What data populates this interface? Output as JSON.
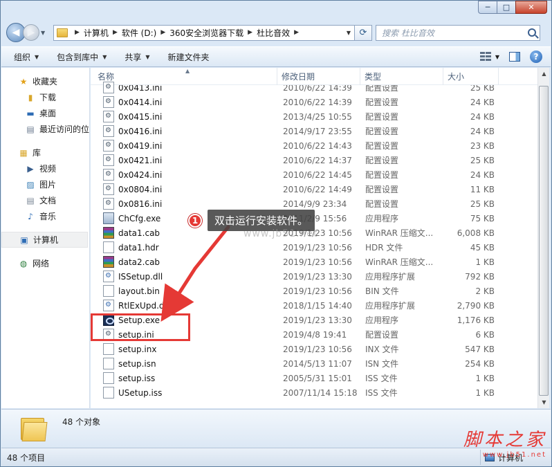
{
  "window": {
    "caption": {
      "min": "─",
      "max": "□",
      "close": "✕"
    }
  },
  "address": {
    "crumbs": [
      "计算机",
      "软件 (D:)",
      "360安全浏览器下载",
      "杜比音效"
    ],
    "search_placeholder": "搜索 杜比音效"
  },
  "commands": [
    {
      "label": "组织",
      "dropdown": true
    },
    {
      "label": "包含到库中",
      "dropdown": true
    },
    {
      "label": "共享",
      "dropdown": true
    },
    {
      "label": "新建文件夹",
      "dropdown": false
    }
  ],
  "nav": {
    "items": [
      {
        "label": "收藏夹",
        "icon": "star-icon",
        "indent": 1,
        "gap_before": 0
      },
      {
        "label": "下载",
        "icon": "download-folder-icon",
        "indent": 2,
        "gap_before": 0
      },
      {
        "label": "桌面",
        "icon": "desktop-icon",
        "indent": 2,
        "gap_before": 0
      },
      {
        "label": "最近访问的位置",
        "icon": "recent-places-icon",
        "indent": 2,
        "gap_before": 0
      },
      {
        "label": "库",
        "icon": "library-icon",
        "indent": 1,
        "gap_before": 1
      },
      {
        "label": "视频",
        "icon": "video-icon",
        "indent": 2,
        "gap_before": 0
      },
      {
        "label": "图片",
        "icon": "pictures-icon",
        "indent": 2,
        "gap_before": 0
      },
      {
        "label": "文档",
        "icon": "documents-icon",
        "indent": 2,
        "gap_before": 0
      },
      {
        "label": "音乐",
        "icon": "music-icon",
        "indent": 2,
        "gap_before": 0
      },
      {
        "label": "计算机",
        "icon": "computer-icon",
        "indent": 1,
        "gap_before": 1,
        "selected": true
      },
      {
        "label": "网络",
        "icon": "network-icon",
        "indent": 1,
        "gap_before": 1
      }
    ]
  },
  "columns": {
    "name": "名称",
    "date": "修改日期",
    "type": "类型",
    "size": "大小"
  },
  "files": [
    {
      "name": "0x0413.ini",
      "date": "2010/6/22 14:39",
      "type": "配置设置",
      "size": "25 KB",
      "kind": "ini"
    },
    {
      "name": "0x0414.ini",
      "date": "2010/6/22 14:39",
      "type": "配置设置",
      "size": "24 KB",
      "kind": "ini"
    },
    {
      "name": "0x0415.ini",
      "date": "2013/4/25 10:55",
      "type": "配置设置",
      "size": "24 KB",
      "kind": "ini"
    },
    {
      "name": "0x0416.ini",
      "date": "2014/9/17 23:55",
      "type": "配置设置",
      "size": "24 KB",
      "kind": "ini"
    },
    {
      "name": "0x0419.ini",
      "date": "2010/6/22 14:43",
      "type": "配置设置",
      "size": "23 KB",
      "kind": "ini"
    },
    {
      "name": "0x0421.ini",
      "date": "2010/6/22 14:37",
      "type": "配置设置",
      "size": "25 KB",
      "kind": "ini"
    },
    {
      "name": "0x0424.ini",
      "date": "2010/6/22 14:45",
      "type": "配置设置",
      "size": "24 KB",
      "kind": "ini"
    },
    {
      "name": "0x0804.ini",
      "date": "2010/6/22 14:49",
      "type": "配置设置",
      "size": "11 KB",
      "kind": "ini"
    },
    {
      "name": "0x0816.ini",
      "date": "2014/9/9 23:34",
      "type": "配置设置",
      "size": "25 KB",
      "kind": "ini"
    },
    {
      "name": "ChCfg.exe",
      "date": "2011/2/9 15:56",
      "type": "应用程序",
      "size": "75 KB",
      "kind": "exe"
    },
    {
      "name": "data1.cab",
      "date": "2019/1/23 10:56",
      "type": "WinRAR 压缩文...",
      "size": "6,008 KB",
      "kind": "cab"
    },
    {
      "name": "data1.hdr",
      "date": "2019/1/23 10:56",
      "type": "HDR 文件",
      "size": "45 KB",
      "kind": "file"
    },
    {
      "name": "data2.cab",
      "date": "2019/1/23 10:56",
      "type": "WinRAR 压缩文...",
      "size": "1 KB",
      "kind": "cab"
    },
    {
      "name": "ISSetup.dll",
      "date": "2019/1/23 13:30",
      "type": "应用程序扩展",
      "size": "792 KB",
      "kind": "dll"
    },
    {
      "name": "layout.bin",
      "date": "2019/1/23 10:56",
      "type": "BIN 文件",
      "size": "2 KB",
      "kind": "file"
    },
    {
      "name": "RtlExUpd.dll",
      "date": "2018/1/15 14:40",
      "type": "应用程序扩展",
      "size": "2,790 KB",
      "kind": "dll"
    },
    {
      "name": "Setup.exe",
      "date": "2019/1/23 13:30",
      "type": "应用程序",
      "size": "1,176 KB",
      "kind": "setup"
    },
    {
      "name": "setup.ini",
      "date": "2019/4/8 19:41",
      "type": "配置设置",
      "size": "6 KB",
      "kind": "ini"
    },
    {
      "name": "setup.inx",
      "date": "2019/1/23 10:56",
      "type": "INX 文件",
      "size": "547 KB",
      "kind": "file"
    },
    {
      "name": "setup.isn",
      "date": "2014/5/13 11:07",
      "type": "ISN 文件",
      "size": "254 KB",
      "kind": "file"
    },
    {
      "name": "setup.iss",
      "date": "2005/5/31 15:01",
      "type": "ISS 文件",
      "size": "1 KB",
      "kind": "file"
    },
    {
      "name": "USetup.iss",
      "date": "2007/11/14 15:18",
      "type": "ISS 文件",
      "size": "1 KB",
      "kind": "file"
    }
  ],
  "details": {
    "count_text": "48 个对象"
  },
  "status": {
    "items_text": "48 个项目",
    "location": "计算机"
  },
  "annotation": {
    "step_number": "1",
    "text": "双击运行安装软件。",
    "highlight_color": "#e53935"
  },
  "watermark": {
    "mid": "www.jb51.net",
    "brand": "脚本之家",
    "url": "www.jb51.net"
  }
}
